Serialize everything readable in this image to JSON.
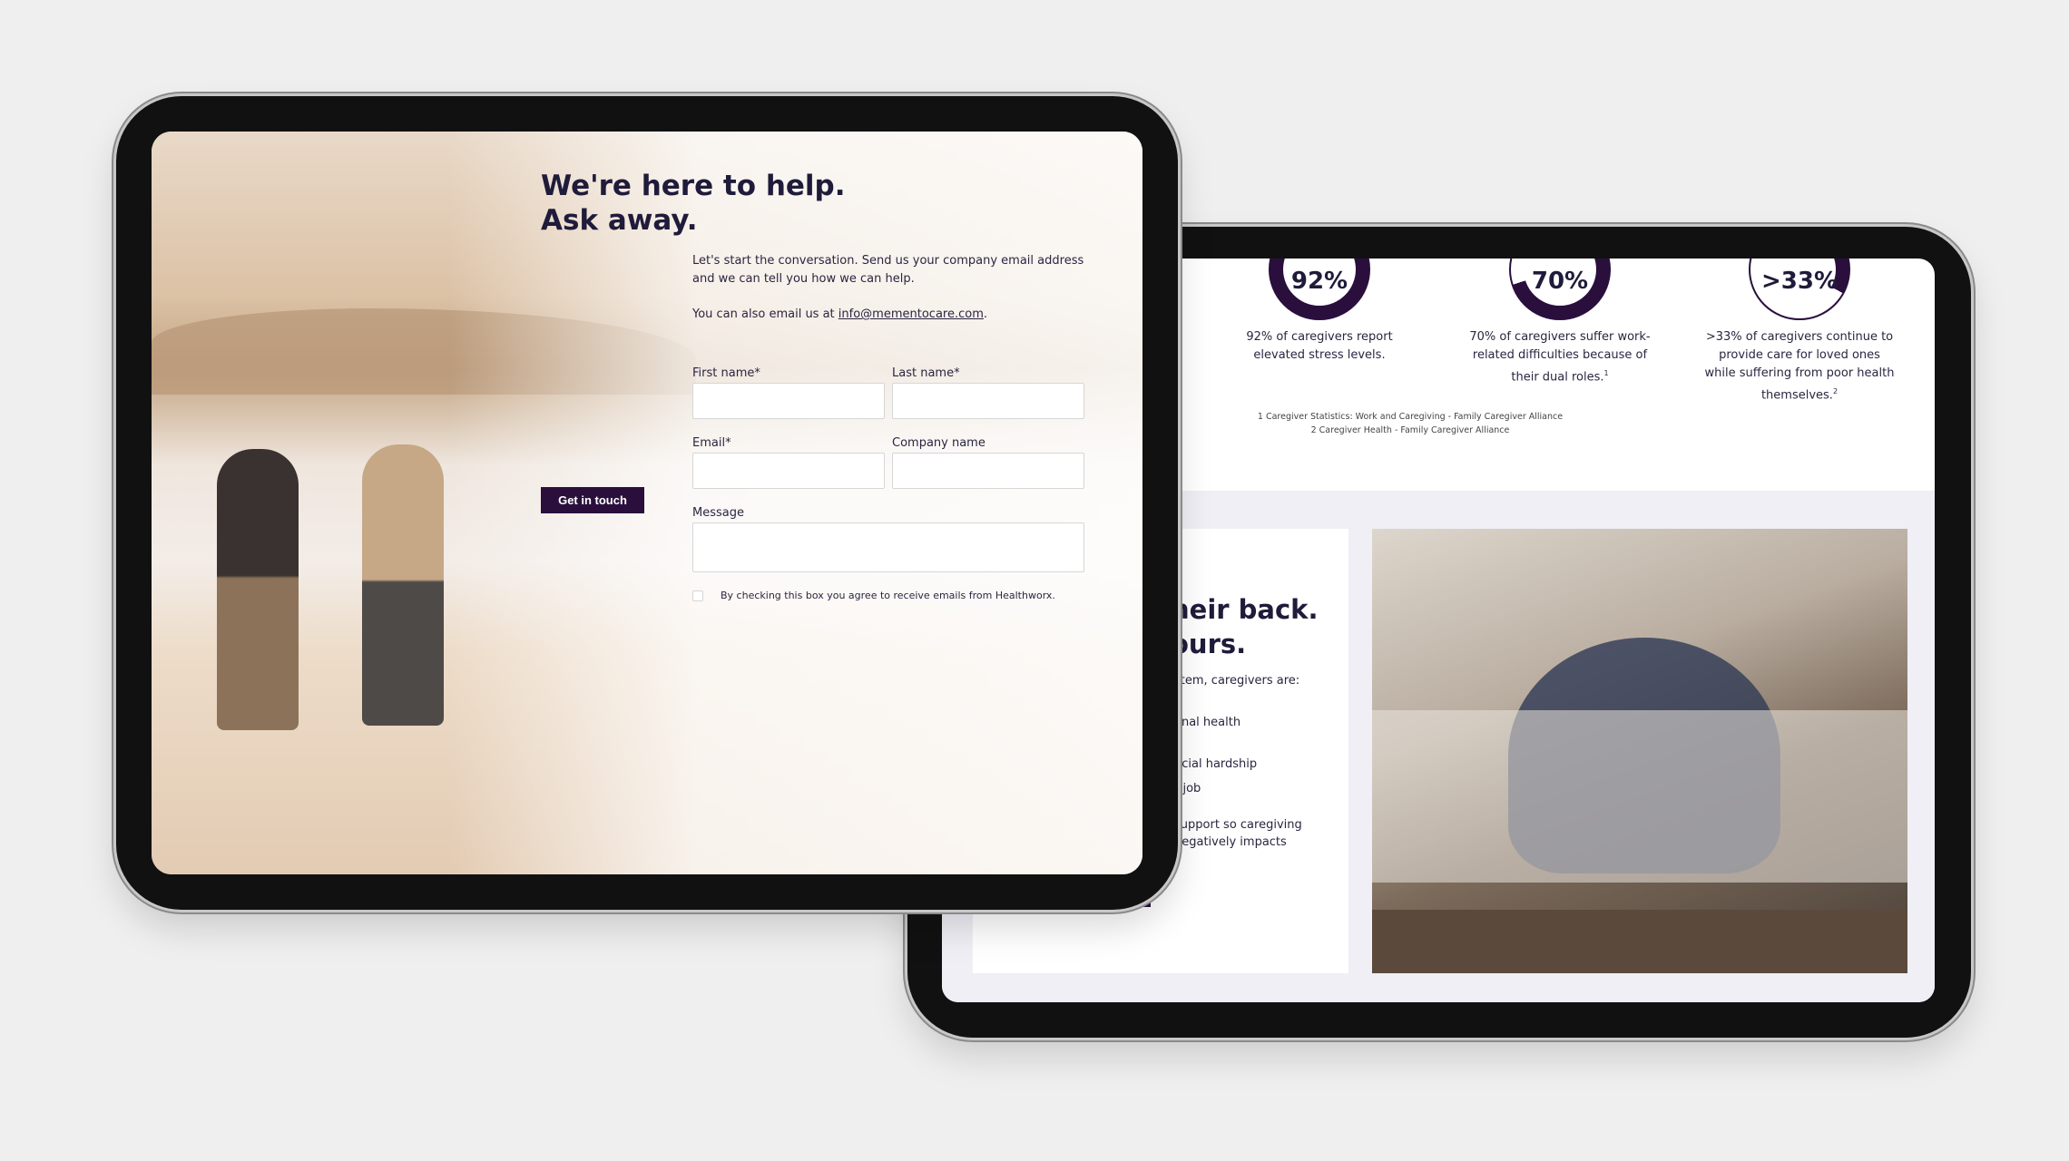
{
  "stats": [
    {
      "value": "92%",
      "percent": 92,
      "text": "92% of caregivers report elevated stress levels.",
      "sup": ""
    },
    {
      "value": "70%",
      "percent": 70,
      "text": "70% of caregivers suffer work-related difficulties because of their dual roles.",
      "sup": "1"
    },
    {
      "value": ">33%",
      "percent": 33,
      "text": ">33% of caregivers continue to provide care for loved ones while suffering from poor health themselves.",
      "sup": "2"
    }
  ],
  "footnotes": [
    "1 Caregiver Statistics: Work and Caregiving - Family Caregiver Alliance",
    "2 Caregiver Health - Family Caregiver Alliance"
  ],
  "back_section": {
    "heading_line1": "heir back.",
    "heading_line2": "ours.",
    "intro": "stem, caregivers are:",
    "items": [
      "onal health",
      "ncial hardship",
      "r job",
      "support so caregiving",
      "negatively impacts"
    ]
  },
  "contact": {
    "title_line1": "We're here to help.",
    "title_line2": "Ask away.",
    "intro": "Let's start the conversation. Send us your company email address and we can tell you how we can help.",
    "email_prefix": "You can also email us at ",
    "email": "info@mementocare.com",
    "email_suffix": ".",
    "fields": {
      "first_name": "First name*",
      "last_name": "Last name*",
      "email": "Email*",
      "company": "Company name",
      "message": "Message"
    },
    "consent": "By checking this box you agree to receive emails from Healthworx.",
    "submit": "Get in touch"
  },
  "colors": {
    "brand": "#2a0f3d",
    "heading": "#1f1b3a"
  }
}
